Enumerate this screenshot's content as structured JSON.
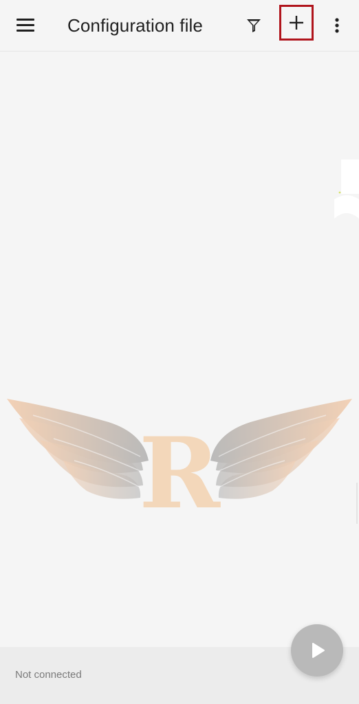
{
  "toolbar": {
    "title": "Configuration file",
    "menu_icon": "menu-icon",
    "filter_icon": "filter-icon",
    "add_icon": "plus-icon",
    "more_icon": "more-vert-icon",
    "highlight_color": "#b0141c"
  },
  "watermark": {
    "logo_letter": "R",
    "logo_icon": "winged-r-logo",
    "colors": {
      "wing": "#f0a060",
      "wing_dark": "#6a6a6a",
      "letter": "#f2b06a"
    }
  },
  "status_bar": {
    "text": "Not connected"
  },
  "fab": {
    "icon": "play-icon",
    "color": "#b9b9b9"
  }
}
